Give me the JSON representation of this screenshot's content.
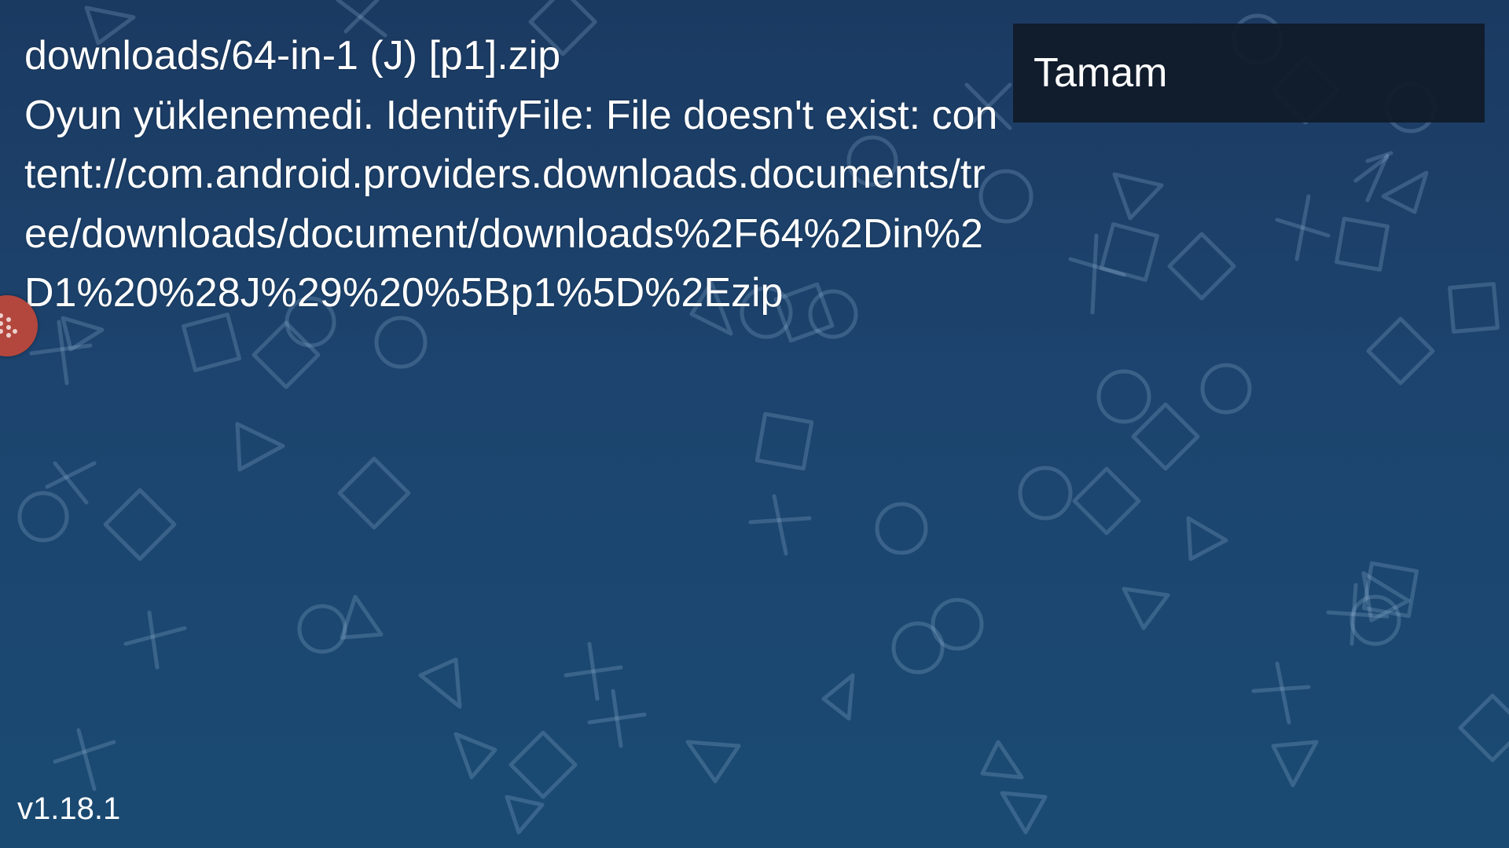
{
  "error": {
    "filename": "downloads/64-in-1 (J) [p1].zip",
    "message": "Oyun yüklenemedi. IdentifyFile: File doesn't exist: content://com.android.providers.downloads.documents/tree/downloads/document/downloads%2F64%2Din%2D1%20%28J%29%20%5Bp1%5D%2Ezip"
  },
  "dialog": {
    "ok_label": "Tamam"
  },
  "footer": {
    "version": "v1.18.1"
  },
  "icons": {
    "side_badge": "gamepad-icon",
    "background": "playstation-symbols-pattern"
  },
  "colors": {
    "background_top": "#1b3a62",
    "background_bottom": "#1a4a72",
    "button_bg": "#101a28",
    "badge": "#b3473d",
    "text": "#ffffff"
  }
}
